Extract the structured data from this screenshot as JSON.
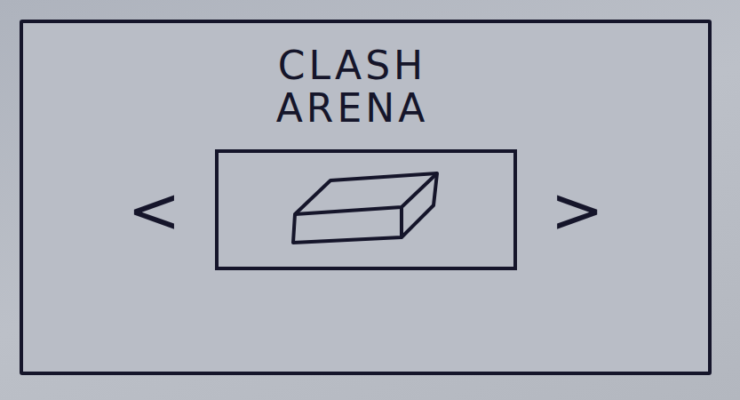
{
  "title": {
    "lines": [
      "CLASH",
      "ARENA"
    ]
  },
  "arrows": {
    "previous": "<",
    "next": ">"
  }
}
